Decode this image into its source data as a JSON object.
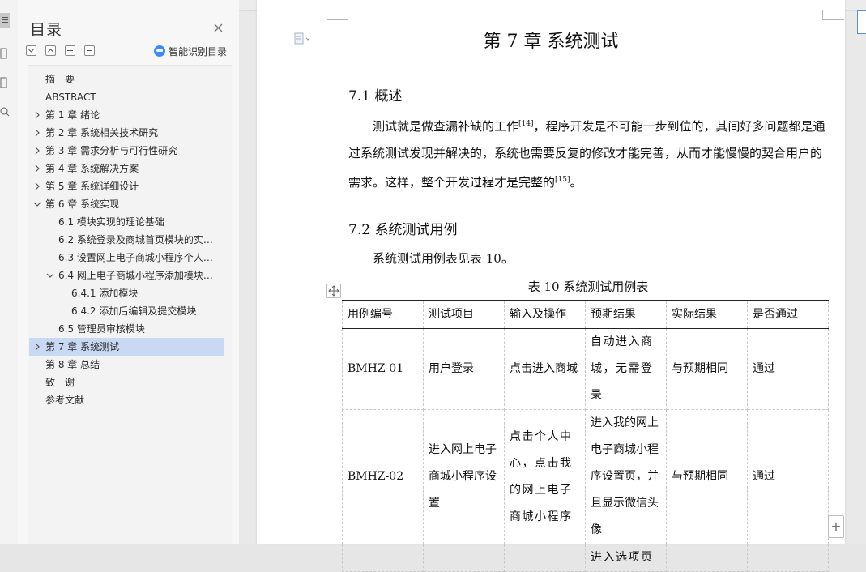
{
  "outline": {
    "title": "目录",
    "smart_button_label": "智能识别目录",
    "items": [
      {
        "label": "摘　要",
        "level": 1,
        "arrow": "none"
      },
      {
        "label": "ABSTRACT",
        "level": 1,
        "arrow": "none"
      },
      {
        "label": "第 1 章  绪论",
        "level": 1,
        "arrow": "right"
      },
      {
        "label": "第 2 章  系统相关技术研究",
        "level": 1,
        "arrow": "right"
      },
      {
        "label": "第 3 章  需求分析与可行性研究",
        "level": 1,
        "arrow": "right"
      },
      {
        "label": "第 4 章  系统解决方案",
        "level": 1,
        "arrow": "right"
      },
      {
        "label": "第 5 章  系统详细设计",
        "level": 1,
        "arrow": "right"
      },
      {
        "label": "第 6 章  系统实现",
        "level": 1,
        "arrow": "down"
      },
      {
        "label": "6.1  模块实现的理论基础",
        "level": 2,
        "arrow": "none"
      },
      {
        "label": "6.2  系统登录及商城首页模块的实…",
        "level": 2,
        "arrow": "none"
      },
      {
        "label": "6.3  设置网上电子商城小程序个人…",
        "level": 2,
        "arrow": "none"
      },
      {
        "label": "6.4  网上电子商城小程序添加模块…",
        "level": 2,
        "arrow": "down"
      },
      {
        "label": "6.4.1  添加模块",
        "level": 3,
        "arrow": "none"
      },
      {
        "label": "6.4.2  添加后编辑及提交模块",
        "level": 3,
        "arrow": "none"
      },
      {
        "label": "6.5  管理员审核模块",
        "level": 2,
        "arrow": "none"
      },
      {
        "label": "第 7 章  系统测试",
        "level": 1,
        "arrow": "right",
        "selected": true
      },
      {
        "label": "第 8 章  总结",
        "level": 1,
        "arrow": "none"
      },
      {
        "label": "致　谢",
        "level": 1,
        "arrow": "none"
      },
      {
        "label": "参考文献",
        "level": 1,
        "arrow": "none"
      }
    ]
  },
  "document": {
    "chapter_title": "第 7 章  系统测试",
    "section1": {
      "heading": "7.1  概述",
      "p1_a": "测试就是做查漏补缺的工作",
      "p1_ref1": "[14]",
      "p1_b": "，程序开发是不可能一步到位的，其间好多问题都是通过系统测试发现并解决的，系统也需要反复的修改才能完善，从而才能慢慢的契合用户的需求。这样，整个开发过程才是完整的",
      "p1_ref2": "[15]",
      "p1_c": "。"
    },
    "section2": {
      "heading": "7.2  系统测试用例",
      "p1": "系统测试用例表见表 10。",
      "caption": "表 10  系统测试用例表"
    },
    "table": {
      "headers": [
        "用例编号",
        "测试项目",
        "输入及操作",
        "预期结果",
        "实际结果",
        "是否通过"
      ],
      "rows": [
        [
          "BMHZ-01",
          "用户登录",
          "点击进入商城",
          "自动进入商城，无需登录",
          "与预期相同",
          "通过"
        ],
        [
          "BMHZ-02",
          "进入网上电子商城小程序设置",
          "点击个人中心，点击我的网上电子商城小程序",
          "进入我的网上电子商城小程序设置页，并且显示微信头像",
          "与预期相同",
          "通过"
        ],
        [
          "",
          "",
          "",
          "进入选项页",
          "",
          ""
        ]
      ]
    }
  },
  "icons": {
    "close": "close-icon",
    "collapse": "collapse-all-icon",
    "expand": "expand-all-icon",
    "add": "add-heading-icon",
    "remove": "remove-heading-icon",
    "smart": "smart-recognize-icon",
    "move": "move-table-icon",
    "add_row": "add-row-icon",
    "doc": "document-icon"
  },
  "colors": {
    "selection": "#c9d9f3",
    "accent": "#3d8af7"
  }
}
